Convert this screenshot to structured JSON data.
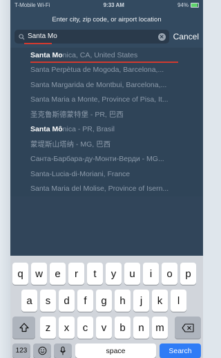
{
  "status_bar": {
    "carrier": "T-Mobile Wi-Fi",
    "time": "9:33 AM",
    "battery": "94%"
  },
  "prompt": "Enter city, zip code, or airport location",
  "search": {
    "value": "Santa Mo",
    "cancel_label": "Cancel"
  },
  "results": [
    {
      "match": "Santa Mo",
      "rest": "nica, CA, United States"
    },
    {
      "match": "",
      "rest": "Santa Perpètua de Mogoda, Barcelona,..."
    },
    {
      "match": "",
      "rest": "Santa Margarida de Montbui, Barcelona,..."
    },
    {
      "match": "",
      "rest": "Santa Maria a Monte, Province of Pisa, It..."
    },
    {
      "match": "",
      "rest": "圣克鲁斯德蒙特堡 - PR, 巴西"
    },
    {
      "match": "Santa Mô",
      "rest": "nica - PR, Brasil"
    },
    {
      "match": "",
      "rest": "蒙堤斯山塔纳 - MG, 巴西"
    },
    {
      "match": "",
      "rest": "Санта-Барбара-ду-Монти-Верди - MG..."
    },
    {
      "match": "",
      "rest": "Santa-Lucia-di-Moriani, France"
    },
    {
      "match": "",
      "rest": "Santa Maria del Molise, Province of Isern..."
    }
  ],
  "keyboard": {
    "row1": [
      "q",
      "w",
      "e",
      "r",
      "t",
      "y",
      "u",
      "i",
      "o",
      "p"
    ],
    "row2": [
      "a",
      "s",
      "d",
      "f",
      "g",
      "h",
      "j",
      "k",
      "l"
    ],
    "row3": [
      "z",
      "x",
      "c",
      "v",
      "b",
      "n",
      "m"
    ],
    "numbers_label": "123",
    "space_label": "space",
    "search_label": "Search"
  },
  "icons": {
    "search": "search-icon",
    "clear": "clear-icon",
    "shift": "shift-icon",
    "delete": "delete-icon",
    "emoji": "emoji-icon",
    "mic": "microphone-icon"
  },
  "colors": {
    "accent_underline": "#d23a2f",
    "search_key": "#2f7cf6"
  }
}
